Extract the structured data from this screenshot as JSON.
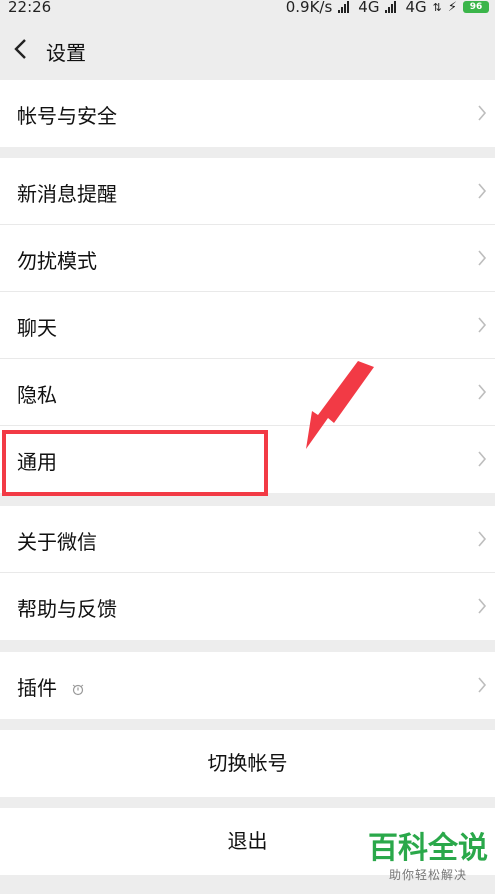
{
  "status": {
    "time": "22:26",
    "speed": "0.9K/s",
    "net1": "4G",
    "net2": "4G",
    "battery": "96"
  },
  "header": {
    "title": "设置"
  },
  "groups": {
    "account": {
      "items": [
        "帐号与安全"
      ]
    },
    "main": {
      "items": [
        "新消息提醒",
        "勿扰模式",
        "聊天",
        "隐私",
        "通用"
      ]
    },
    "about": {
      "items": [
        "关于微信",
        "帮助与反馈"
      ]
    },
    "plugins": {
      "items": [
        "插件"
      ]
    },
    "switch_account": "切换帐号",
    "logout": "退出"
  },
  "annotation": {
    "highlight_color": "#f23a45"
  },
  "watermark": {
    "main": "百科全说",
    "sub": "助你轻松解决"
  }
}
